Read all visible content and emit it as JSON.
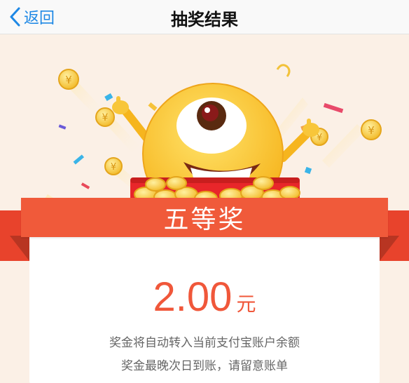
{
  "nav": {
    "back_label": "返回",
    "title": "抽奖结果"
  },
  "result": {
    "prize_name": "五等奖",
    "amount": "2.00",
    "unit": "元",
    "note_line1": "奖金将自动转入当前支付宝账户余额",
    "note_line2": "奖金最晚次日到账，请留意账单"
  },
  "colors": {
    "accent_blue": "#1e88e5",
    "ribbon_red": "#f05a3a",
    "amount_red": "#f0573a",
    "coin_gold": "#f5c23a"
  },
  "icons": [
    "chevron-left-icon",
    "emoji-mascot-icon",
    "coin-icon",
    "red-envelope-icon",
    "confetti-icon"
  ]
}
